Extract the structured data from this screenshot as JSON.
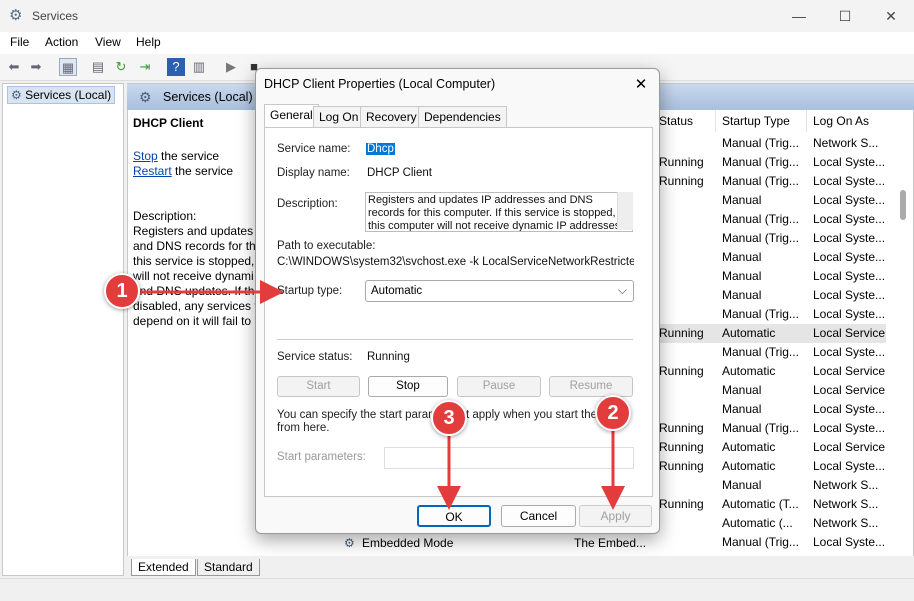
{
  "window": {
    "title": "Services",
    "min_icon": "—",
    "max_icon": "☐",
    "close_icon": "✕"
  },
  "menu": [
    "File",
    "Action",
    "View",
    "Help"
  ],
  "left_pane": {
    "item": "Services (Local)"
  },
  "header": {
    "title": "Services (Local)"
  },
  "detail": {
    "service_title": "DHCP Client",
    "stop_link": "Stop",
    "stop_rest": " the service",
    "restart_link": "Restart",
    "restart_rest": " the service",
    "description_label": "Description:",
    "description_lines": [
      "Registers and updates I",
      "and DNS records for thi",
      "this service is stopped, t",
      "will not receive dynami",
      "and DNS updates. If thi",
      "disabled, any services t",
      "depend on it will fail to"
    ]
  },
  "columns": {
    "status": "Status",
    "startup_type": "Startup Type",
    "log_on_as": "Log On As"
  },
  "rows": [
    {
      "status": "",
      "startup": "Manual (Trig...",
      "logon": "Network S..."
    },
    {
      "status": "Running",
      "startup": "Manual (Trig...",
      "logon": "Local Syste..."
    },
    {
      "status": "Running",
      "startup": "Manual (Trig...",
      "logon": "Local Syste..."
    },
    {
      "status": "",
      "startup": "Manual",
      "logon": "Local Syste..."
    },
    {
      "status": "",
      "startup": "Manual (Trig...",
      "logon": "Local Syste..."
    },
    {
      "status": "",
      "startup": "Manual (Trig...",
      "logon": "Local Syste..."
    },
    {
      "status": "",
      "startup": "Manual",
      "logon": "Local Syste..."
    },
    {
      "status": "",
      "startup": "Manual",
      "logon": "Local Syste..."
    },
    {
      "status": "",
      "startup": "Manual",
      "logon": "Local Syste..."
    },
    {
      "status": "",
      "startup": "Manual (Trig...",
      "logon": "Local Syste..."
    },
    {
      "status": "Running",
      "startup": "Automatic",
      "logon": "Local Service"
    },
    {
      "status": "",
      "startup": "Manual (Trig...",
      "logon": "Local Syste..."
    },
    {
      "status": "Running",
      "startup": "Automatic",
      "logon": "Local Service"
    },
    {
      "status": "",
      "startup": "Manual",
      "logon": "Local Service"
    },
    {
      "status": "",
      "startup": "Manual",
      "logon": "Local Syste..."
    },
    {
      "status": "Running",
      "startup": "Manual (Trig...",
      "logon": "Local Syste..."
    },
    {
      "status": "Running",
      "startup": "Automatic",
      "logon": "Local Service"
    },
    {
      "status": "Running",
      "startup": "Automatic",
      "logon": "Local Syste..."
    },
    {
      "status": "",
      "startup": "Manual",
      "logon": "Network S..."
    },
    {
      "status": "Running",
      "startup": "Automatic (T...",
      "logon": "Network S..."
    },
    {
      "status": "",
      "startup": "Automatic (...",
      "logon": "Network S..."
    },
    {
      "status": "",
      "startup": "Manual (Trig...",
      "logon": "Local Syste..."
    }
  ],
  "last_visible_row": {
    "name": "Embedded Mode",
    "description": "The Embed..."
  },
  "bottom_tabs": [
    "Extended",
    "Standard"
  ],
  "dialog": {
    "title": "DHCP Client Properties (Local Computer)",
    "tabs": [
      "General",
      "Log On",
      "Recovery",
      "Dependencies"
    ],
    "service_name_label": "Service name:",
    "service_name": "Dhcp",
    "display_name_label": "Display name:",
    "display_name": "DHCP Client",
    "description_label": "Description:",
    "description": "Registers and updates IP addresses and DNS records for this computer. If this service is stopped, this computer will not receive dynamic IP addresses",
    "path_label": "Path to executable:",
    "path": "C:\\WINDOWS\\system32\\svchost.exe -k LocalServiceNetworkRestricted -p",
    "startup_type_label": "Startup type:",
    "startup_type": "Automatic",
    "service_status_label": "Service status:",
    "service_status": "Running",
    "buttons": {
      "start": "Start",
      "stop": "Stop",
      "pause": "Pause",
      "resume": "Resume"
    },
    "params_note_1": "You can specify the start parame",
    "params_note_2": "t apply when you start the s",
    "params_note_3": "from here.",
    "start_params_label": "Start parameters:",
    "ok": "OK",
    "cancel": "Cancel",
    "apply": "Apply"
  },
  "annotations": {
    "badge1": "1",
    "badge2": "2",
    "badge3": "3",
    "color": "#e23c3c"
  }
}
